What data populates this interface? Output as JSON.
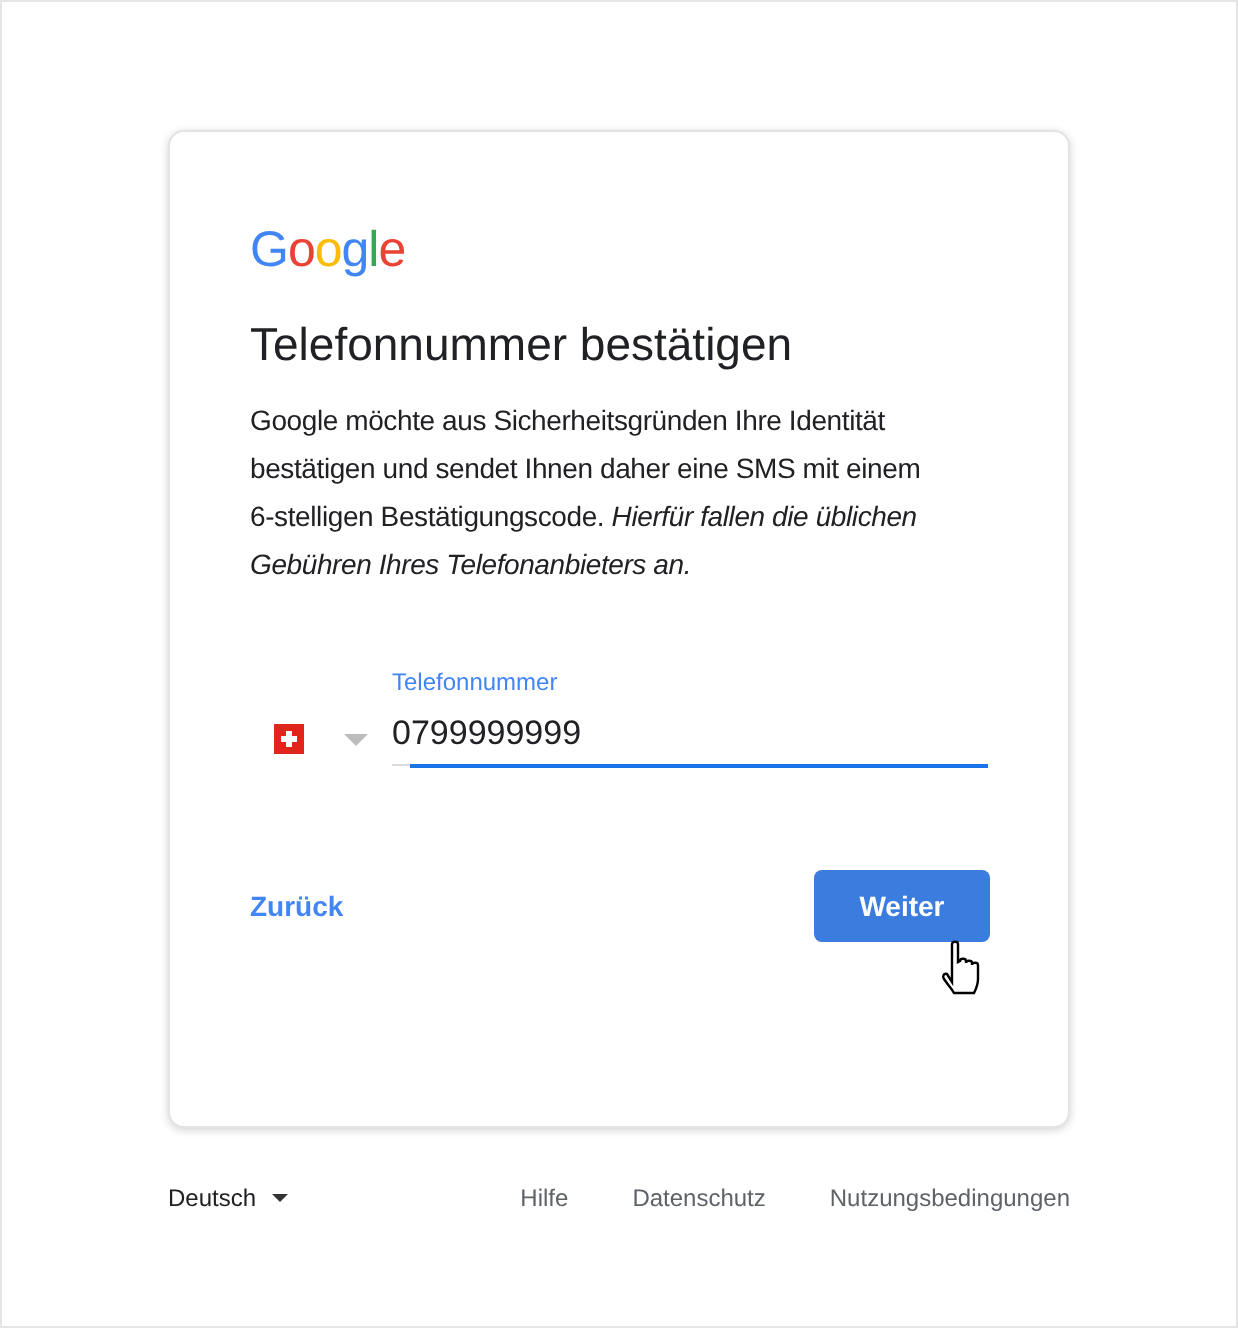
{
  "logo": "Google",
  "title": "Telefonnummer bestätigen",
  "description": "Google möchte aus Sicherheitsgründen Ihre Identität bestätigen und sendet Ihnen daher eine SMS mit einem 6-stelligen Bestätigungscode. *Hierfür fallen die üblichen Gebühren Ihres Telefonanbieters an.*",
  "phone_field": {
    "label": "Telefonnummer",
    "value": "0799999999",
    "focused": true
  },
  "back_link": "Zurück",
  "next_button": "Weiter",
  "footer": {
    "language": "Deutsch",
    "links": [
      "Hilfe",
      "Datenschutz",
      "Nutzungsbedingungen"
    ]
  }
}
